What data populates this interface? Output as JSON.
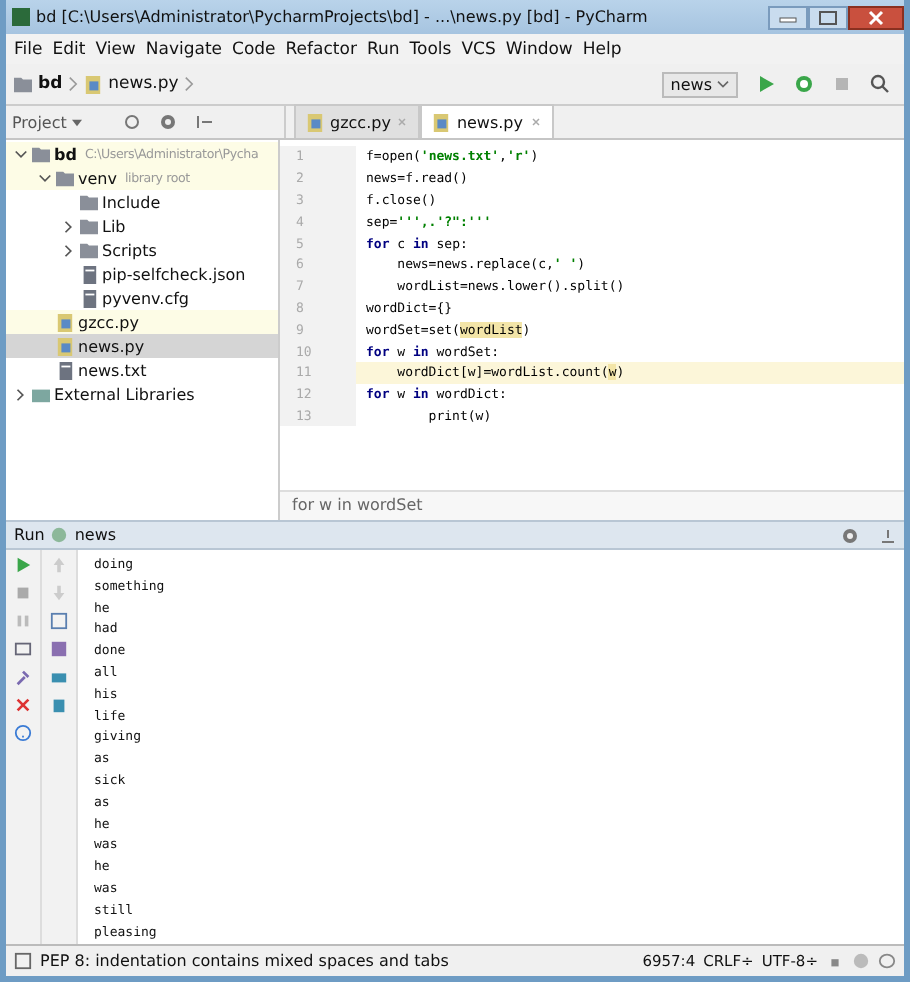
{
  "window": {
    "title": "bd [C:\\Users\\Administrator\\PycharmProjects\\bd] - ...\\news.py [bd] - PyCharm"
  },
  "menu": [
    "File",
    "Edit",
    "View",
    "Navigate",
    "Code",
    "Refactor",
    "Run",
    "Tools",
    "VCS",
    "Window",
    "Help"
  ],
  "breadcrumbs": [
    "bd",
    "news.py"
  ],
  "run_config": "news",
  "project_panel": {
    "title": "Project"
  },
  "tabs": [
    {
      "label": "gzcc.py",
      "selected": false
    },
    {
      "label": "news.py",
      "selected": true
    }
  ],
  "tree": [
    {
      "label": "bd",
      "note": "C:\\Users\\Administrator\\Pycha",
      "kind": "folder",
      "expanded": true,
      "selected": false,
      "children": [
        {
          "label": "venv",
          "note": "library root",
          "kind": "folder",
          "expanded": true,
          "selected": false,
          "children": [
            {
              "label": "Include",
              "kind": "folder",
              "selected": false
            },
            {
              "label": "Lib",
              "kind": "folder",
              "expanded": false,
              "selected": false
            },
            {
              "label": "Scripts",
              "kind": "folder",
              "expanded": false,
              "selected": false
            },
            {
              "label": "pip-selfcheck.json",
              "kind": "file",
              "selected": false
            },
            {
              "label": "pyvenv.cfg",
              "kind": "file",
              "selected": false
            }
          ]
        },
        {
          "label": "gzcc.py",
          "kind": "py",
          "selected": false
        },
        {
          "label": "news.py",
          "kind": "py",
          "selected": true
        },
        {
          "label": "news.txt",
          "kind": "file",
          "selected": false
        }
      ]
    },
    {
      "label": "External Libraries",
      "kind": "lib",
      "expanded": false,
      "selected": false
    }
  ],
  "code": [
    {
      "number": "1",
      "current": false,
      "tokens": [
        {
          "text": "f=open(",
          "kind": "plain"
        },
        {
          "text": "'news.txt'",
          "kind": "str"
        },
        {
          "text": ",",
          "kind": "plain"
        },
        {
          "text": "'r'",
          "kind": "str"
        },
        {
          "text": ")",
          "kind": "plain"
        }
      ]
    },
    {
      "number": "2",
      "current": false,
      "tokens": [
        {
          "text": "news=f.read()",
          "kind": "plain"
        }
      ]
    },
    {
      "number": "3",
      "current": false,
      "tokens": [
        {
          "text": "f.close()",
          "kind": "plain"
        }
      ]
    },
    {
      "number": "4",
      "current": false,
      "tokens": [
        {
          "text": "sep=",
          "kind": "plain"
        },
        {
          "text": "''',.'?\":'''",
          "kind": "str"
        }
      ]
    },
    {
      "number": "5",
      "current": false,
      "tokens": [
        {
          "text": "for",
          "kind": "kw"
        },
        {
          "text": " c ",
          "kind": "plain"
        },
        {
          "text": "in",
          "kind": "kw"
        },
        {
          "text": " sep:",
          "kind": "plain"
        }
      ]
    },
    {
      "number": "6",
      "current": false,
      "tokens": [
        {
          "text": "    news=news.replace(c,",
          "kind": "plain"
        },
        {
          "text": "' '",
          "kind": "str"
        },
        {
          "text": ")",
          "kind": "plain"
        }
      ]
    },
    {
      "number": "7",
      "current": false,
      "tokens": [
        {
          "text": "    wordList=news.lower().split()",
          "kind": "plain"
        }
      ]
    },
    {
      "number": "8",
      "current": false,
      "tokens": [
        {
          "text": "wordDict={}",
          "kind": "plain"
        }
      ]
    },
    {
      "number": "9",
      "current": false,
      "tokens": [
        {
          "text": "wordSet=set(",
          "kind": "plain"
        },
        {
          "text": "wordList",
          "kind": "mark"
        },
        {
          "text": ")",
          "kind": "plain"
        }
      ]
    },
    {
      "number": "10",
      "current": false,
      "tokens": [
        {
          "text": "for",
          "kind": "kw"
        },
        {
          "text": " w ",
          "kind": "plain"
        },
        {
          "text": "in",
          "kind": "kw"
        },
        {
          "text": " wordSet:",
          "kind": "plain"
        }
      ]
    },
    {
      "number": "11",
      "current": true,
      "tokens": [
        {
          "text": "    wordDict[w]=wordList.count(",
          "kind": "plain"
        },
        {
          "text": "w",
          "kind": "mark"
        },
        {
          "text": ")",
          "kind": "plain"
        }
      ]
    },
    {
      "number": "12",
      "current": false,
      "tokens": [
        {
          "text": "for",
          "kind": "kw"
        },
        {
          "text": " w ",
          "kind": "plain"
        },
        {
          "text": "in",
          "kind": "kw"
        },
        {
          "text": " wordDict:",
          "kind": "plain"
        }
      ]
    },
    {
      "number": "13",
      "current": false,
      "tokens": [
        {
          "text": "        print(w)",
          "kind": "plain"
        }
      ]
    }
  ],
  "editor_breadcrumb": "for w in wordSet",
  "run_panel": {
    "label": "Run",
    "config": "news"
  },
  "output": [
    "doing",
    "something",
    "he",
    "had",
    "done",
    "all",
    "his",
    "life",
    "giving",
    "as",
    "sick",
    "as",
    "he",
    "was",
    "he",
    "was",
    "still",
    "pleasing"
  ],
  "status_bar": {
    "message": "PEP 8: indentation contains mixed spaces and tabs",
    "position": "6957:4",
    "line_sep": "CRLF÷",
    "encoding": "UTF-8÷"
  }
}
